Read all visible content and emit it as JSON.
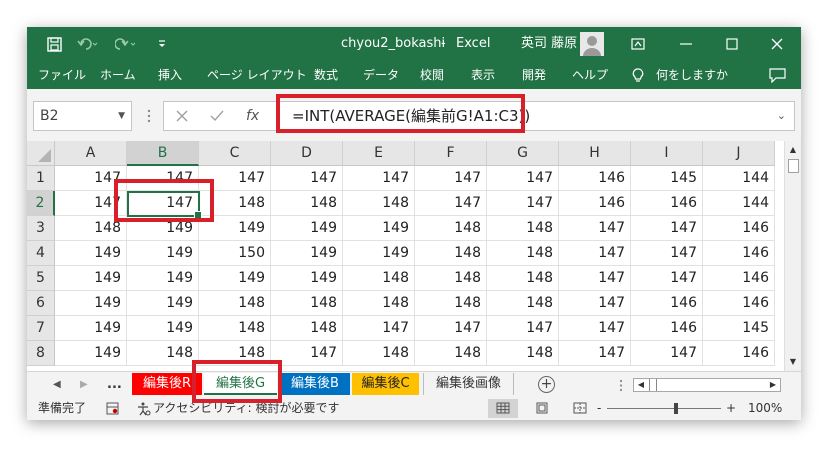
{
  "titlebar": {
    "filename": "chyou2_bokashi",
    "separator": "-",
    "app": "Excel",
    "user": "英司 藤原"
  },
  "ribbon": {
    "tabs": [
      "ファイル",
      "ホーム",
      "挿入",
      "ページ レイアウト",
      "数式",
      "データ",
      "校閲",
      "表示",
      "開発",
      "ヘルプ"
    ],
    "tell_me": "何をしますか"
  },
  "formula_bar": {
    "name_box": "B2",
    "fx": "fx",
    "formula": "=INT(AVERAGE(編集前G!A1:C3))"
  },
  "grid": {
    "columns": [
      "A",
      "B",
      "C",
      "D",
      "E",
      "F",
      "G",
      "H",
      "I",
      "J"
    ],
    "rows": [
      {
        "num": "1",
        "values": [
          "147",
          "147",
          "147",
          "147",
          "147",
          "147",
          "147",
          "146",
          "145",
          "144"
        ]
      },
      {
        "num": "2",
        "values": [
          "147",
          "147",
          "148",
          "148",
          "148",
          "147",
          "147",
          "146",
          "146",
          "144"
        ]
      },
      {
        "num": "3",
        "values": [
          "148",
          "149",
          "149",
          "149",
          "149",
          "148",
          "148",
          "147",
          "147",
          "146"
        ]
      },
      {
        "num": "4",
        "values": [
          "149",
          "149",
          "150",
          "149",
          "149",
          "148",
          "148",
          "147",
          "147",
          "146"
        ]
      },
      {
        "num": "5",
        "values": [
          "149",
          "149",
          "149",
          "149",
          "148",
          "148",
          "148",
          "147",
          "147",
          "146"
        ]
      },
      {
        "num": "6",
        "values": [
          "149",
          "149",
          "148",
          "148",
          "148",
          "148",
          "148",
          "147",
          "146",
          "146"
        ]
      },
      {
        "num": "7",
        "values": [
          "149",
          "149",
          "148",
          "148",
          "147",
          "147",
          "147",
          "147",
          "146",
          "145"
        ]
      },
      {
        "num": "8",
        "values": [
          "149",
          "148",
          "148",
          "147",
          "148",
          "148",
          "148",
          "147",
          "147",
          "146"
        ]
      }
    ],
    "active_cell": "B2"
  },
  "sheet_tabs": {
    "ellipsis": "...",
    "tabs": [
      {
        "label": "編集後R",
        "bg": "#ff0000",
        "fg": "#ffffff"
      },
      {
        "label": "編集後G",
        "bg": "#ffffff",
        "fg": "#217346"
      },
      {
        "label": "編集後B",
        "bg": "#0070c0",
        "fg": "#ffffff"
      },
      {
        "label": "編集後C",
        "bg": "#ffc000",
        "fg": "#222222"
      },
      {
        "label": "編集後画像",
        "bg": "#f3f3f3",
        "fg": "#333333"
      }
    ],
    "add": "+"
  },
  "status_bar": {
    "ready": "準備完了",
    "accessibility": "アクセシビリティ: 検討が必要です",
    "zoom_minus": "-",
    "zoom_plus": "+",
    "zoom": "100%",
    "zoom_fraction": 0.5
  },
  "colors": {
    "accent": "#217346",
    "annotation": "#d8202a"
  }
}
